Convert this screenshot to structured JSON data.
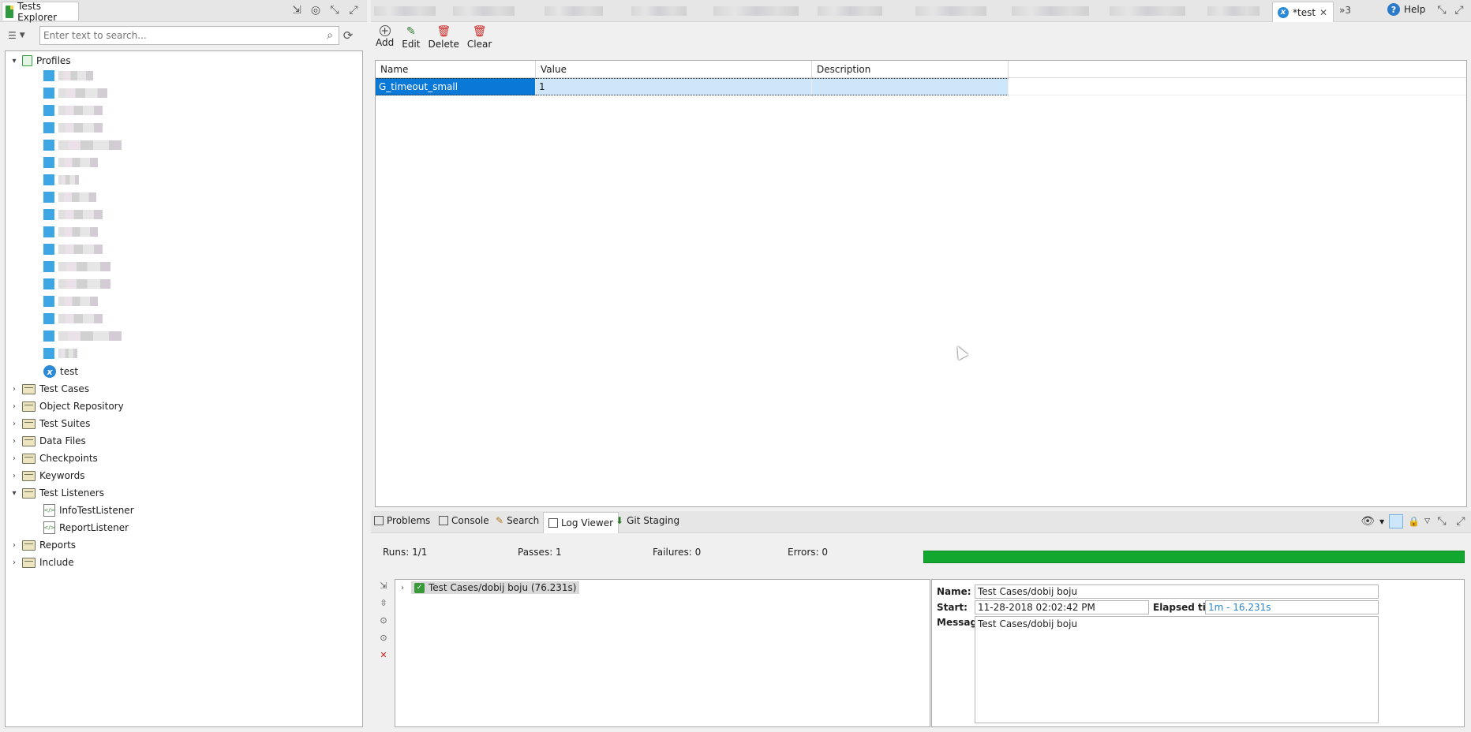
{
  "left_panel": {
    "tab_title": "Tests Explorer",
    "search_placeholder": "Enter text to search...",
    "tree": {
      "profiles_label": "Profiles",
      "profile_test": "test",
      "items": [
        {
          "label": "Test Cases"
        },
        {
          "label": "Object Repository"
        },
        {
          "label": "Test Suites"
        },
        {
          "label": "Data Files"
        },
        {
          "label": "Checkpoints"
        },
        {
          "label": "Keywords"
        },
        {
          "label": "Test Listeners"
        }
      ],
      "listeners": [
        "InfoTestListener",
        "ReportListener"
      ],
      "after_items": [
        {
          "label": "Reports"
        },
        {
          "label": "Include"
        }
      ]
    }
  },
  "editor": {
    "active_tab": "*test",
    "overflow_count": "»3",
    "help_label": "Help",
    "toolbar": {
      "add": "Add",
      "edit": "Edit",
      "delete": "Delete",
      "clear": "Clear"
    },
    "table": {
      "columns": [
        "Name",
        "Value",
        "Description"
      ],
      "rows": [
        {
          "name": "G_timeout_small",
          "value": "1",
          "description": ""
        }
      ]
    }
  },
  "bottom_panel": {
    "tabs": [
      "Problems",
      "Console",
      "Search",
      "Log Viewer",
      "Git Staging"
    ],
    "active_tab": "Log Viewer",
    "stats": {
      "runs": "Runs:  1/1",
      "passes": "Passes:  1",
      "failures": "Failures:  0",
      "errors": "Errors:  0"
    },
    "progress_fraction": 1.0,
    "result_node": "Test Cases/dobij boju (76.231s)",
    "details": {
      "name_label": "Name:",
      "name_value": "Test Cases/dobij boju",
      "start_label": "Start:",
      "start_value": "11-28-2018 02:02:42 PM",
      "elapsed_label": "Elapsed time:",
      "elapsed_value": "1m - 16.231s",
      "message_label": "Message:",
      "message_value": "Test Cases/dobij boju"
    }
  },
  "colors": {
    "selection": "#0a78d7",
    "progress": "#12a72e",
    "accent_blue": "#2b8ad8"
  }
}
